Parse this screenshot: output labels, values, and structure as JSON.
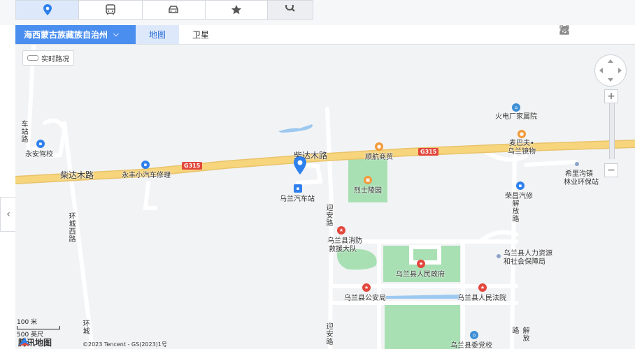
{
  "mode_tabs": [
    {
      "icon": "location-pin-icon",
      "active": true
    },
    {
      "icon": "bus-icon",
      "active": false
    },
    {
      "icon": "car-icon",
      "active": false
    },
    {
      "icon": "star-icon",
      "active": false
    }
  ],
  "search_icon": "search-icon",
  "header": {
    "city": "海西蒙古族藏族自治州",
    "map_types": [
      "地图",
      "卫星"
    ]
  },
  "tools": [
    "pin-tool-icon",
    "share-icon",
    "ruler-icon",
    "trash-icon",
    "fullscreen-icon"
  ],
  "traffic_label": "实时路况",
  "roads": {
    "chaidamu_1": "柴达木路",
    "chaidamu_2": "柴达木路",
    "g315_1": "G315",
    "g315_2": "G315",
    "chezhan": "车站路",
    "huancheng_west": "环城西路",
    "huancheng": "环城",
    "yingan_1": "迎安路",
    "yingan_2": "迎安路",
    "jiefang_1": "解放路",
    "jiefang_2": "解放路"
  },
  "pois": {
    "yongan": "永安驾校",
    "yongfeng": "永丰小汽车修理",
    "shunhang": "顺航商贸",
    "lieshi": "烈士陵园",
    "wulan_station": "乌兰汽车站",
    "huodian": "火电厂家属院",
    "maibafu_1": "麦巴夫•",
    "maibafu_2": "乌兰镜物",
    "xili_1": "希里沟镇",
    "xili_2": "林业环保站",
    "rongchang": "荣昌汽修",
    "fire_1": "乌兰县消防",
    "fire_2": "救援大队",
    "hr_1": "乌兰县人力资源",
    "hr_2": "和社会保障局",
    "gov": "乌兰县人民政府",
    "police": "乌兰县公安局",
    "court": "乌兰县人民法院",
    "party": "乌兰县委党校"
  },
  "scale": {
    "metric": "100 米",
    "imperial": "500 英尺"
  },
  "logo": "腾讯地图",
  "copyright": "©2023 Tencent - GS(2023)1号",
  "colors": {
    "accent": "#4a8ef0",
    "road_main": "#f7d57c",
    "green": "#a8e0b4",
    "water": "#9dc9f0"
  }
}
